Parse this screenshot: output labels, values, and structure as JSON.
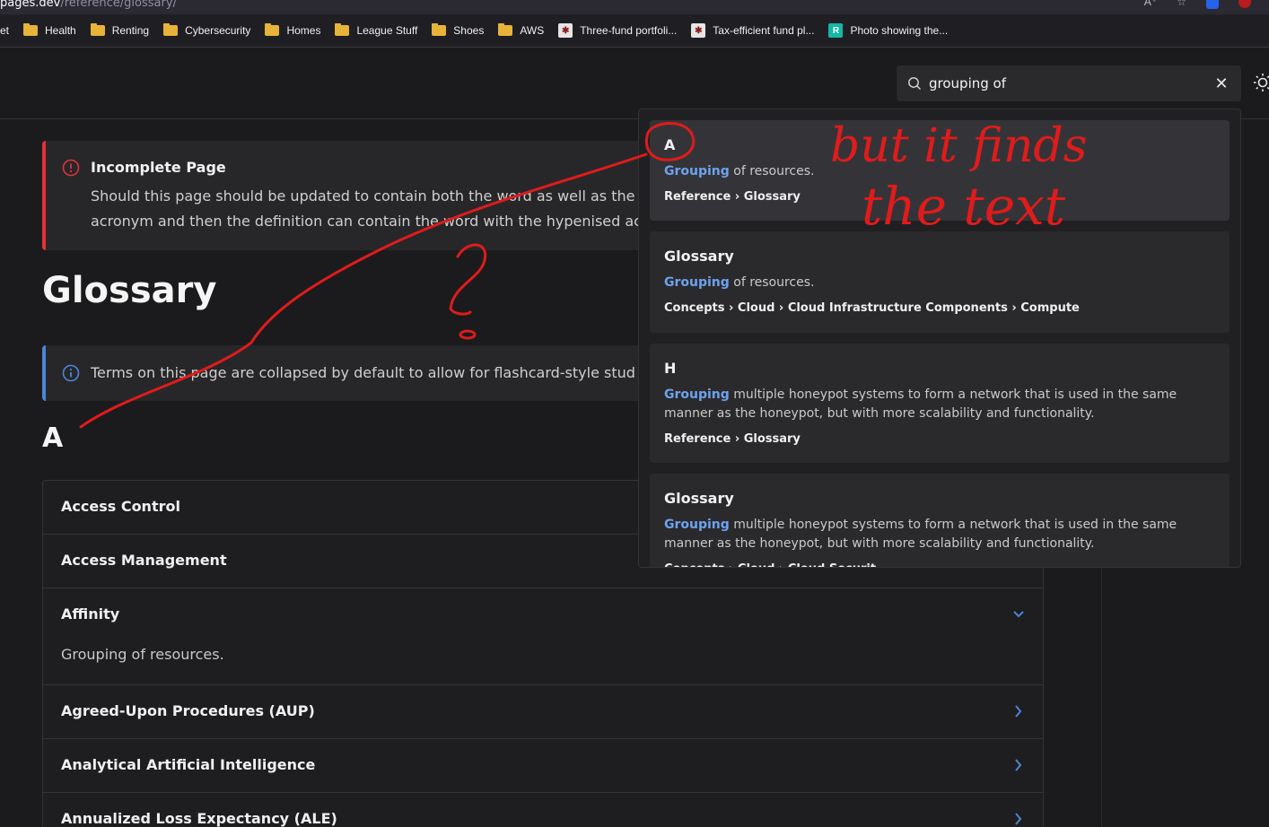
{
  "browser": {
    "url_host": "pages.dev",
    "url_path": "/reference/glossary/",
    "reader_label": "A⁺"
  },
  "bookmarks": [
    {
      "label": "et",
      "type": "none"
    },
    {
      "label": "Health",
      "type": "folder"
    },
    {
      "label": "Renting",
      "type": "folder"
    },
    {
      "label": "Cybersecurity",
      "type": "folder"
    },
    {
      "label": "Homes",
      "type": "folder"
    },
    {
      "label": "League Stuff",
      "type": "folder"
    },
    {
      "label": "Shoes",
      "type": "folder"
    },
    {
      "label": "AWS",
      "type": "folder"
    },
    {
      "label": "Three-fund portfoli...",
      "type": "site",
      "icon": "vanguard-icon"
    },
    {
      "label": "Tax-efficient fund pl...",
      "type": "site",
      "icon": "vanguard-icon"
    },
    {
      "label": "Photo showing the...",
      "type": "site",
      "icon": "r-site-icon"
    }
  ],
  "search": {
    "value": "grouping of",
    "icon": "search-icon",
    "clear_icon": "close-icon"
  },
  "admonitions": {
    "danger": {
      "title": "Incomplete Page",
      "body_line1": "Should this page should be updated to contain both the word as well as the h",
      "body_line2": "acronym and then the definition can contain the word with the hypenised ac"
    },
    "info": {
      "body": "Terms on this page are collapsed by default to allow for flashcard-style stud"
    }
  },
  "page": {
    "title": "Glossary",
    "letter": "A"
  },
  "terms": [
    {
      "name": "Access Control",
      "open": false,
      "def": ""
    },
    {
      "name": "Access Management",
      "open": false,
      "def": ""
    },
    {
      "name": "Affinity",
      "open": true,
      "def": "Grouping of resources."
    },
    {
      "name": "Agreed-Upon Procedures (AUP)",
      "open": false,
      "def": ""
    },
    {
      "name": "Analytical Artificial Intelligence",
      "open": false,
      "def": ""
    },
    {
      "name": "Annualized Loss Expectancy (ALE)",
      "open": false,
      "def": ""
    }
  ],
  "results": [
    {
      "title": "A",
      "highlight": "Grouping",
      "rest_line1": " of resources.",
      "rest_line2": "",
      "path": "Reference › Glossary"
    },
    {
      "title": "Glossary",
      "highlight": "Grouping",
      "rest_line1": " of resources.",
      "rest_line2": "",
      "path": "Concepts › Cloud › Cloud Infrastructure Components › Compute"
    },
    {
      "title": "H",
      "highlight": "Grouping",
      "rest_line1": " multiple honeypot systems to form a network that is used in the same",
      "rest_line2": "manner as the honeypot, but with more scalability and functionality.",
      "path": "Reference › Glossary"
    },
    {
      "title": "Glossary",
      "highlight": "Grouping",
      "rest_line1": " multiple honeypot systems to form a network that is used in the same",
      "rest_line2": "manner as the honeypot, but with more scalability and functionality.",
      "path": "Concepts › Cloud › Cloud Securit..."
    }
  ],
  "annotation": {
    "line1": "but it finds",
    "line2": "the text",
    "mark": "?",
    "color": "#e01b1b"
  },
  "colors": {
    "danger": "#e13238",
    "info": "#4a86d8",
    "highlight": "#6ea2ef",
    "accent_chevron": "#4a86d8"
  }
}
